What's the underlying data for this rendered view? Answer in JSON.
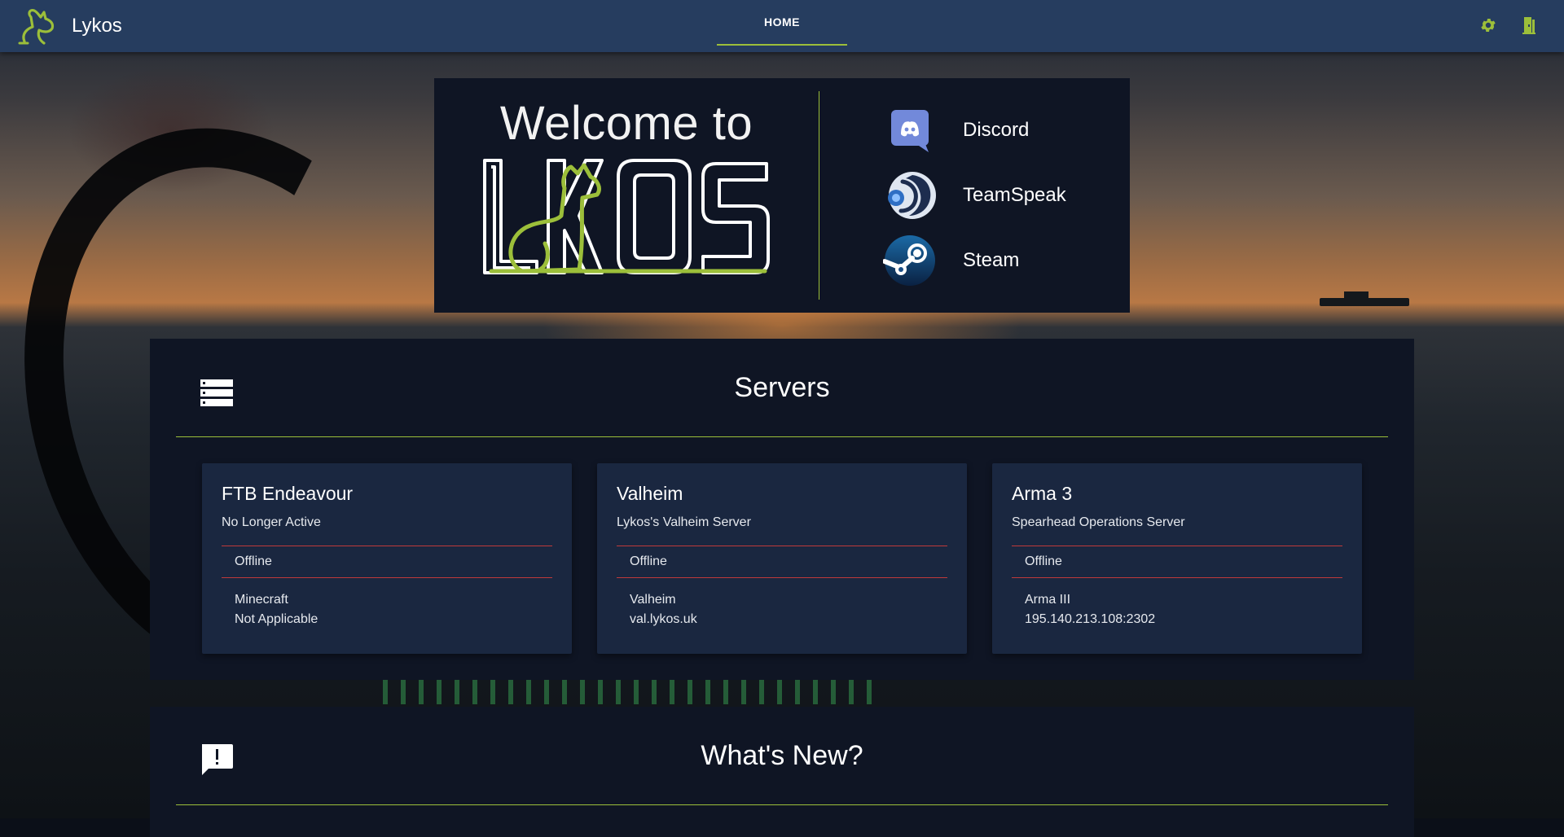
{
  "app": {
    "name": "Lykos"
  },
  "nav": {
    "home": "HOME"
  },
  "topbar": {
    "icons": [
      "settings-gear-icon",
      "logout-door-icon"
    ],
    "accent_color": "#9cbf3a"
  },
  "welcome": {
    "title": "Welcome to",
    "logo_text": "LYKOS",
    "socials": [
      {
        "label": "Discord",
        "icon": "discord-icon"
      },
      {
        "label": "TeamSpeak",
        "icon": "teamspeak-icon"
      },
      {
        "label": "Steam",
        "icon": "steam-icon"
      }
    ]
  },
  "servers": {
    "title": "Servers",
    "icon": "server-list-icon",
    "cards": [
      {
        "name": "FTB Endeavour",
        "description": "No Longer Active",
        "status": "Offline",
        "game": "Minecraft",
        "address": "Not Applicable"
      },
      {
        "name": "Valheim",
        "description": "Lykos's Valheim Server",
        "status": "Offline",
        "game": "Valheim",
        "address": "val.lykos.uk"
      },
      {
        "name": "Arma 3",
        "description": "Spearhead Operations Server",
        "status": "Offline",
        "game": "Arma III",
        "address": "195.140.213.108:2302"
      }
    ]
  },
  "news": {
    "title": "What's New?",
    "icon": "announcement-icon"
  },
  "colors": {
    "topbar": "#263d5f",
    "panel": "#0f1524",
    "card": "#1a2740",
    "accent": "#9cbf3a",
    "status_rule": "#c0393b"
  }
}
